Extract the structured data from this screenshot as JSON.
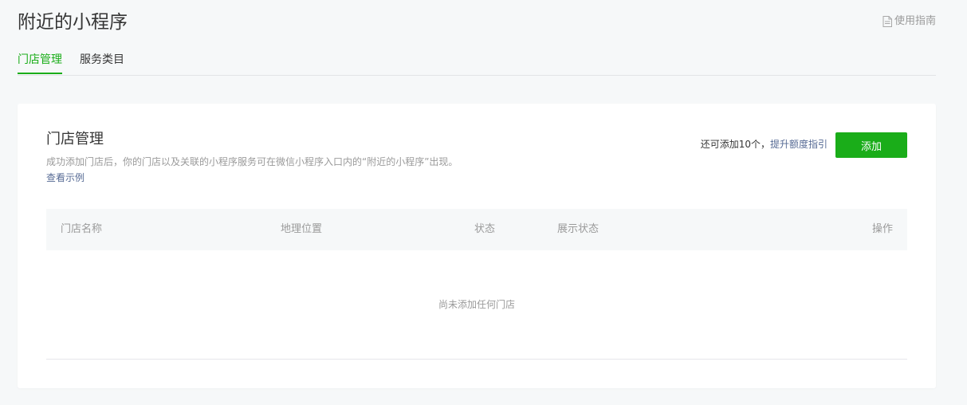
{
  "page": {
    "title": "附近的小程序",
    "guide_label": "使用指南"
  },
  "tabs": [
    {
      "label": "门店管理",
      "active": true
    },
    {
      "label": "服务类目",
      "active": false
    }
  ],
  "card": {
    "title": "门店管理",
    "description": "成功添加门店后，你的门店以及关联的小程序服务可在微信小程序入口内的“附近的小程序”出现。",
    "example_link": "查看示例",
    "quota_text": "还可添加10个，",
    "quota_link": "提升额度指引",
    "add_button": "添加"
  },
  "table": {
    "columns": [
      "门店名称",
      "地理位置",
      "状态",
      "展示状态",
      "操作"
    ],
    "empty_text": "尚未添加任何门店"
  },
  "colors": {
    "accent": "#1aad19",
    "link": "#576b95",
    "muted": "#9a9a9a",
    "text": "#353535",
    "background": "#f6f8f9"
  }
}
